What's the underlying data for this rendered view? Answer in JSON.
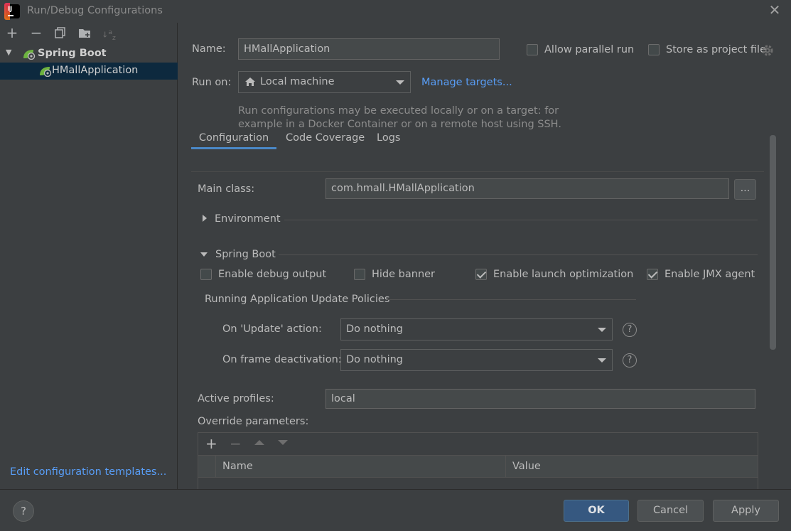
{
  "window": {
    "title": "Run/Debug Configurations"
  },
  "toolbar": {
    "add": "+",
    "remove": "−"
  },
  "tree": {
    "group": "Spring Boot",
    "item": "HMallApplication"
  },
  "left_footer": {
    "edit_templates": "Edit configuration templates..."
  },
  "name_label": "Name:",
  "name_value": "HMallApplication",
  "allow_parallel": "Allow parallel run",
  "store_project": "Store as project file",
  "run_on_label": "Run on:",
  "run_on_value": "Local machine",
  "manage_targets": "Manage targets...",
  "run_hint_1": "Run configurations may be executed locally or on a target: for",
  "run_hint_2": "example in a Docker Container or on a remote host using SSH.",
  "tabs": [
    "Configuration",
    "Code Coverage",
    "Logs"
  ],
  "main_class_label": "Main class:",
  "main_class_value": "com.hmall.HMallApplication",
  "browse": "...",
  "environment": "Environment",
  "spring_boot": "Spring Boot",
  "options": {
    "debug": "Enable debug output",
    "hide_banner": "Hide banner",
    "launch_opt": "Enable launch optimization",
    "jmx": "Enable JMX agent"
  },
  "policies_title": "Running Application Update Policies",
  "update_label": "On 'Update' action:",
  "update_value": "Do nothing",
  "frame_label": "On frame deactivation:",
  "frame_value": "Do nothing",
  "help": "?",
  "active_profiles_label": "Active profiles:",
  "active_profiles_value": "local",
  "override_label": "Override parameters:",
  "table": {
    "col_name": "Name",
    "col_value": "Value"
  },
  "buttons": {
    "ok": "OK",
    "cancel": "Cancel",
    "apply": "Apply"
  },
  "colors": {
    "accent": "#4a88c7",
    "link": "#589df6",
    "bg": "#3c3f41",
    "selection": "#0d293e"
  }
}
